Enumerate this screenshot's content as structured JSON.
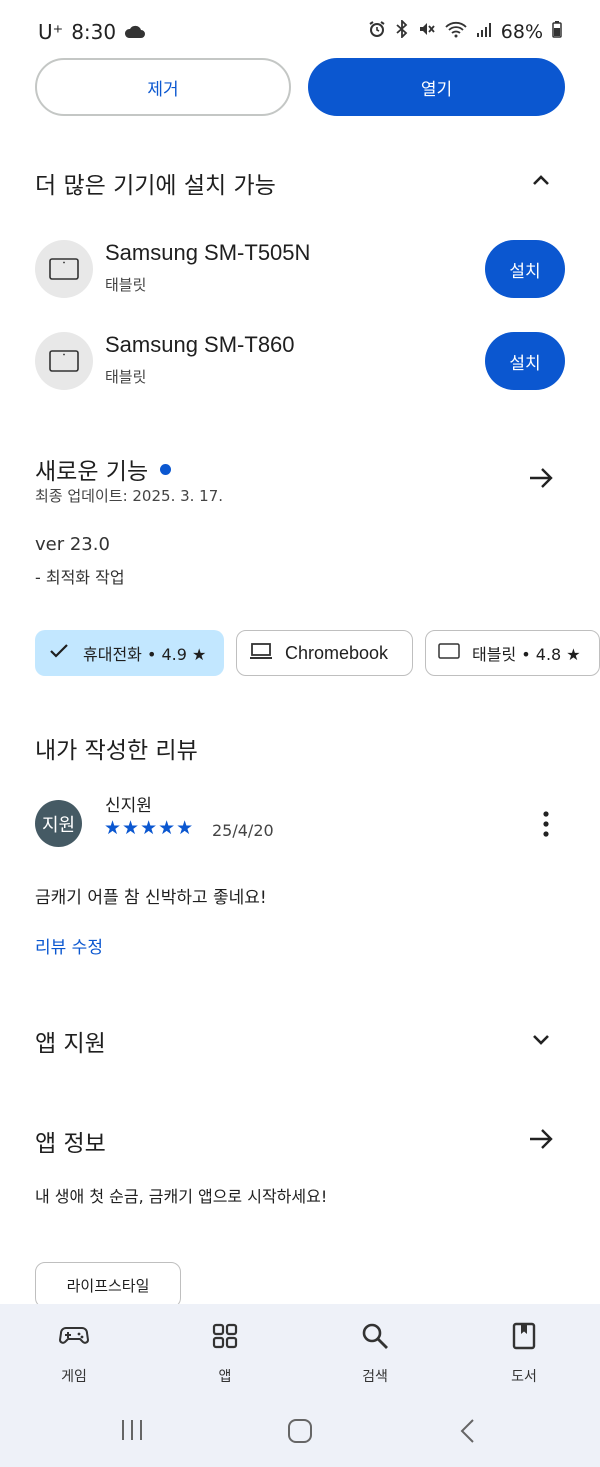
{
  "status_bar": {
    "carrier": "U⁺",
    "time": "8:30",
    "battery": "68%"
  },
  "actions": {
    "remove_label": "제거",
    "open_label": "열기"
  },
  "more_devices": {
    "title": "더 많은 기기에 설치 가능",
    "devices": [
      {
        "name": "Samsung SM-T505N",
        "type": "태블릿",
        "install_label": "설치"
      },
      {
        "name": "Samsung SM-T860",
        "type": "태블릿",
        "install_label": "설치"
      }
    ]
  },
  "whats_new": {
    "title": "새로운 기능",
    "updated": "최종 업데이트: 2025. 3. 17.",
    "version": "ver 23.0",
    "notes": "- 최적화 작업"
  },
  "device_chips": [
    {
      "label": "휴대전화 • 4.9 ★",
      "selected": true,
      "icon": "check-icon"
    },
    {
      "label": "Chromebook",
      "selected": false,
      "icon": "laptop-icon"
    },
    {
      "label": "태블릿 • 4.8 ★",
      "selected": false,
      "icon": "tablet-icon"
    }
  ],
  "my_review": {
    "title": "내가 작성한 리뷰",
    "avatar_text": "지원",
    "reviewer": "신지원",
    "stars": "★★★★★",
    "rating": 5,
    "date": "25/4/20",
    "text": "금캐기 어플 참 신박하고 좋네요!",
    "edit_label": "리뷰 수정"
  },
  "app_support": {
    "title": "앱 지원"
  },
  "app_info": {
    "title": "앱 정보",
    "description": "내 생애 첫 순금, 금캐기 앱으로 시작하세요!",
    "tag": "라이프스타일"
  },
  "bottom_nav": [
    {
      "label": "게임",
      "icon": "gamepad-icon"
    },
    {
      "label": "앱",
      "icon": "apps-grid-icon"
    },
    {
      "label": "검색",
      "icon": "search-icon"
    },
    {
      "label": "도서",
      "icon": "book-icon"
    }
  ],
  "colors": {
    "accent": "#0b57d0",
    "chip_selected_bg": "#c2e7ff",
    "nav_bg": "#eef1f8",
    "avatar_bg": "#455a64"
  }
}
